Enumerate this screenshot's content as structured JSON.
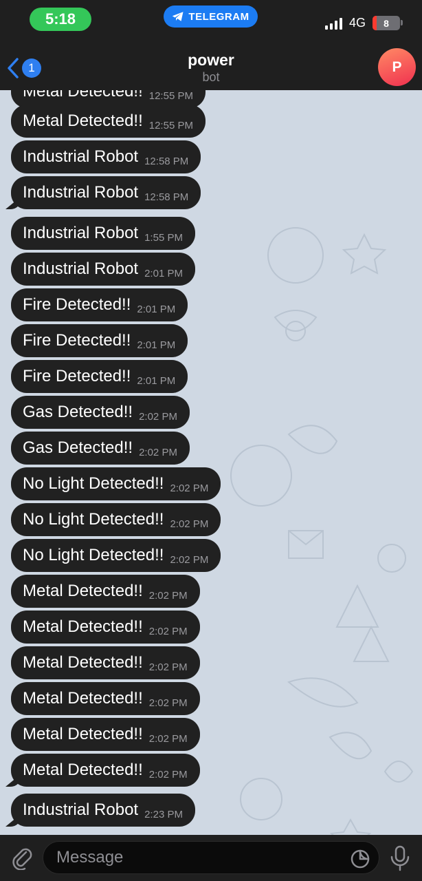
{
  "status_bar": {
    "time": "5:18",
    "app_label": "TELEGRAM",
    "network": "4G",
    "battery": "8"
  },
  "header": {
    "back_badge": "1",
    "title": "power",
    "subtitle": "bot",
    "avatar_letter": "P"
  },
  "messages": [
    {
      "text": "Metal Detected!!",
      "time": "12:55 PM"
    },
    {
      "text": "Metal Detected!!",
      "time": "12:55 PM"
    },
    {
      "text": "Industrial Robot",
      "time": "12:58 PM"
    },
    {
      "text": "Industrial Robot",
      "time": "12:58 PM"
    },
    {
      "text": "Industrial Robot",
      "time": "1:55 PM"
    },
    {
      "text": "Industrial Robot",
      "time": "2:01 PM"
    },
    {
      "text": "Fire Detected!!",
      "time": "2:01 PM"
    },
    {
      "text": "Fire Detected!!",
      "time": "2:01 PM"
    },
    {
      "text": "Fire Detected!!",
      "time": "2:01 PM"
    },
    {
      "text": "Gas Detected!!",
      "time": "2:02 PM"
    },
    {
      "text": "Gas Detected!!",
      "time": "2:02 PM"
    },
    {
      "text": "No Light Detected!!",
      "time": "2:02 PM"
    },
    {
      "text": "No Light Detected!!",
      "time": "2:02 PM"
    },
    {
      "text": "No Light Detected!!",
      "time": "2:02 PM"
    },
    {
      "text": "Metal Detected!!",
      "time": "2:02 PM"
    },
    {
      "text": "Metal Detected!!",
      "time": "2:02 PM"
    },
    {
      "text": "Metal Detected!!",
      "time": "2:02 PM"
    },
    {
      "text": "Metal Detected!!",
      "time": "2:02 PM"
    },
    {
      "text": "Metal Detected!!",
      "time": "2:02 PM"
    },
    {
      "text": "Metal Detected!!",
      "time": "2:02 PM"
    },
    {
      "text": "Industrial Robot",
      "time": "2:23 PM"
    }
  ],
  "input": {
    "placeholder": "Message"
  },
  "icons": {
    "back": "chevron-left-icon",
    "telegram": "telegram-icon",
    "attach": "paperclip-icon",
    "sticker": "sticker-icon",
    "mic": "microphone-icon"
  },
  "colors": {
    "background": "#cfd8e3",
    "bubble": "#212121",
    "accent": "#2f7ff0",
    "time_pill": "#34c759"
  }
}
